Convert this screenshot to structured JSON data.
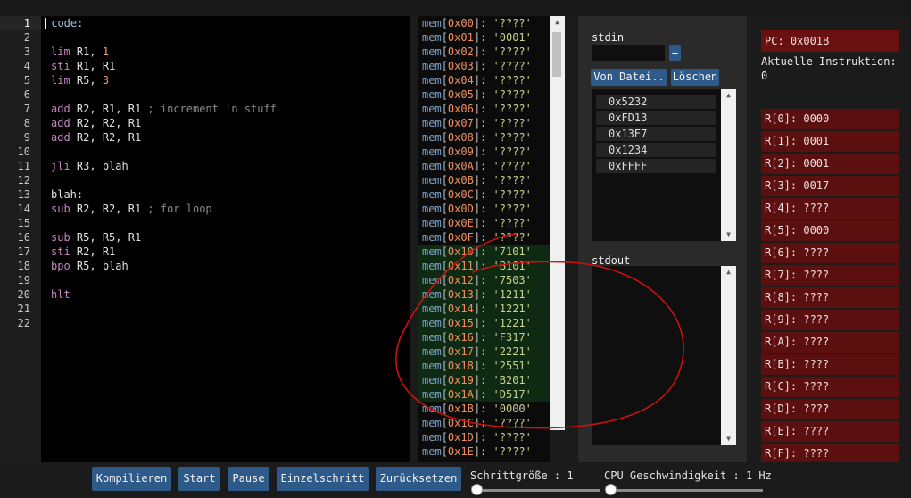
{
  "editor": {
    "title": "_code:",
    "line_numbers": [
      "1",
      "2",
      "3",
      "4",
      "5",
      "6",
      "7",
      "8",
      "9",
      "10",
      "11",
      "12",
      "13",
      "14",
      "15",
      "16",
      "17",
      "18",
      "19",
      "20",
      "21",
      "22"
    ],
    "lines": [
      {
        "op": "lim",
        "args": "R1, ",
        "num": "1",
        "comment": ""
      },
      {
        "op": "sti",
        "args": "R1, R1",
        "num": "",
        "comment": ""
      },
      {
        "op": "lim",
        "args": "R5, ",
        "num": "3",
        "comment": ""
      },
      {
        "op": "add",
        "args": "R2, R1, R1 ",
        "num": "",
        "comment": "; increment 'n stuff"
      },
      {
        "op": "add",
        "args": "R2, R2, R1",
        "num": "",
        "comment": ""
      },
      {
        "op": "add",
        "args": "R2, R2, R1",
        "num": "",
        "comment": ""
      },
      {
        "op": "jli",
        "args": "R3, blah",
        "num": "",
        "comment": ""
      },
      {
        "op": "blah:",
        "args": "",
        "num": "",
        "comment": ""
      },
      {
        "op": "sub",
        "args": "R2, R2, R1 ",
        "num": "",
        "comment": "; for loop"
      },
      {
        "op": "sub",
        "args": "R5, R5, R1",
        "num": "",
        "comment": ""
      },
      {
        "op": "sti",
        "args": "R2, R1",
        "num": "",
        "comment": ""
      },
      {
        "op": "bpo",
        "args": "R5, blah",
        "num": "",
        "comment": ""
      },
      {
        "op": "hlt",
        "args": "",
        "num": "",
        "comment": ""
      }
    ]
  },
  "memory": [
    {
      "name": "mem",
      "addr": "0x00",
      "value": "????"
    },
    {
      "name": "mem",
      "addr": "0x01",
      "value": "0001"
    },
    {
      "name": "mem",
      "addr": "0x02",
      "value": "????"
    },
    {
      "name": "mem",
      "addr": "0x03",
      "value": "????"
    },
    {
      "name": "mem",
      "addr": "0x04",
      "value": "????"
    },
    {
      "name": "mem",
      "addr": "0x05",
      "value": "????"
    },
    {
      "name": "mem",
      "addr": "0x06",
      "value": "????"
    },
    {
      "name": "mem",
      "addr": "0x07",
      "value": "????"
    },
    {
      "name": "mem",
      "addr": "0x08",
      "value": "????"
    },
    {
      "name": "mem",
      "addr": "0x09",
      "value": "????"
    },
    {
      "name": "mem",
      "addr": "0x0A",
      "value": "????"
    },
    {
      "name": "mem",
      "addr": "0x0B",
      "value": "????"
    },
    {
      "name": "mem",
      "addr": "0x0C",
      "value": "????"
    },
    {
      "name": "mem",
      "addr": "0x0D",
      "value": "????"
    },
    {
      "name": "mem",
      "addr": "0x0E",
      "value": "????"
    },
    {
      "name": "mem",
      "addr": "0x0F",
      "value": "????"
    },
    {
      "name": "mem",
      "addr": "0x10",
      "value": "7101"
    },
    {
      "name": "mem",
      "addr": "0x11",
      "value": "B101"
    },
    {
      "name": "mem",
      "addr": "0x12",
      "value": "7503"
    },
    {
      "name": "mem",
      "addr": "0x13",
      "value": "1211"
    },
    {
      "name": "mem",
      "addr": "0x14",
      "value": "1221"
    },
    {
      "name": "mem",
      "addr": "0x15",
      "value": "1221"
    },
    {
      "name": "mem",
      "addr": "0x16",
      "value": "F317"
    },
    {
      "name": "mem",
      "addr": "0x17",
      "value": "2221"
    },
    {
      "name": "mem",
      "addr": "0x18",
      "value": "2551"
    },
    {
      "name": "mem",
      "addr": "0x19",
      "value": "B201"
    },
    {
      "name": "mem",
      "addr": "0x1A",
      "value": "D517"
    },
    {
      "name": "mem",
      "addr": "0x1B",
      "value": "0000"
    },
    {
      "name": "mem",
      "addr": "0x1C",
      "value": "????"
    },
    {
      "name": "mem",
      "addr": "0x1D",
      "value": "????"
    },
    {
      "name": "mem",
      "addr": "0x1E",
      "value": "????"
    }
  ],
  "io": {
    "stdin_label": "stdin",
    "plus_label": "+",
    "from_file_label": "Von Datei..",
    "clear_label": "Löschen",
    "stdin_items": [
      "0x5232",
      "0xFD13",
      "0x13E7",
      "0x1234",
      "0xFFFF"
    ],
    "stdout_label": "stdout"
  },
  "cpu": {
    "pc": "PC: 0x001B",
    "instruction_label": "Aktuelle Instruktion:",
    "instruction_value": "0",
    "registers": [
      "R[0]: 0000",
      "R[1]: 0001",
      "R[2]: 0001",
      "R[3]: 0017",
      "R[4]: ????",
      "R[5]: 0000",
      "R[6]: ????",
      "R[7]: ????",
      "R[8]: ????",
      "R[9]: ????",
      "R[A]: ????",
      "R[B]: ????",
      "R[C]: ????",
      "R[D]: ????",
      "R[E]: ????",
      "R[F]: ????"
    ]
  },
  "controls": {
    "compile_label": "Kompilieren",
    "start_label": "Start",
    "pause_label": "Pause",
    "step_label": "Einzelschritt",
    "reset_label": "Zurücksetzen",
    "step_size_label": "Schrittgröße : 1",
    "cpu_speed_label": "CPU Geschwindigkeit : 1 Hz",
    "step_size_value": 1,
    "cpu_speed_value": 1
  },
  "colors": {
    "accent": "#2d5a88",
    "register_bg": "#5c0f0f",
    "highlight_green": "#0e2a12",
    "annotation": "#d01010"
  }
}
